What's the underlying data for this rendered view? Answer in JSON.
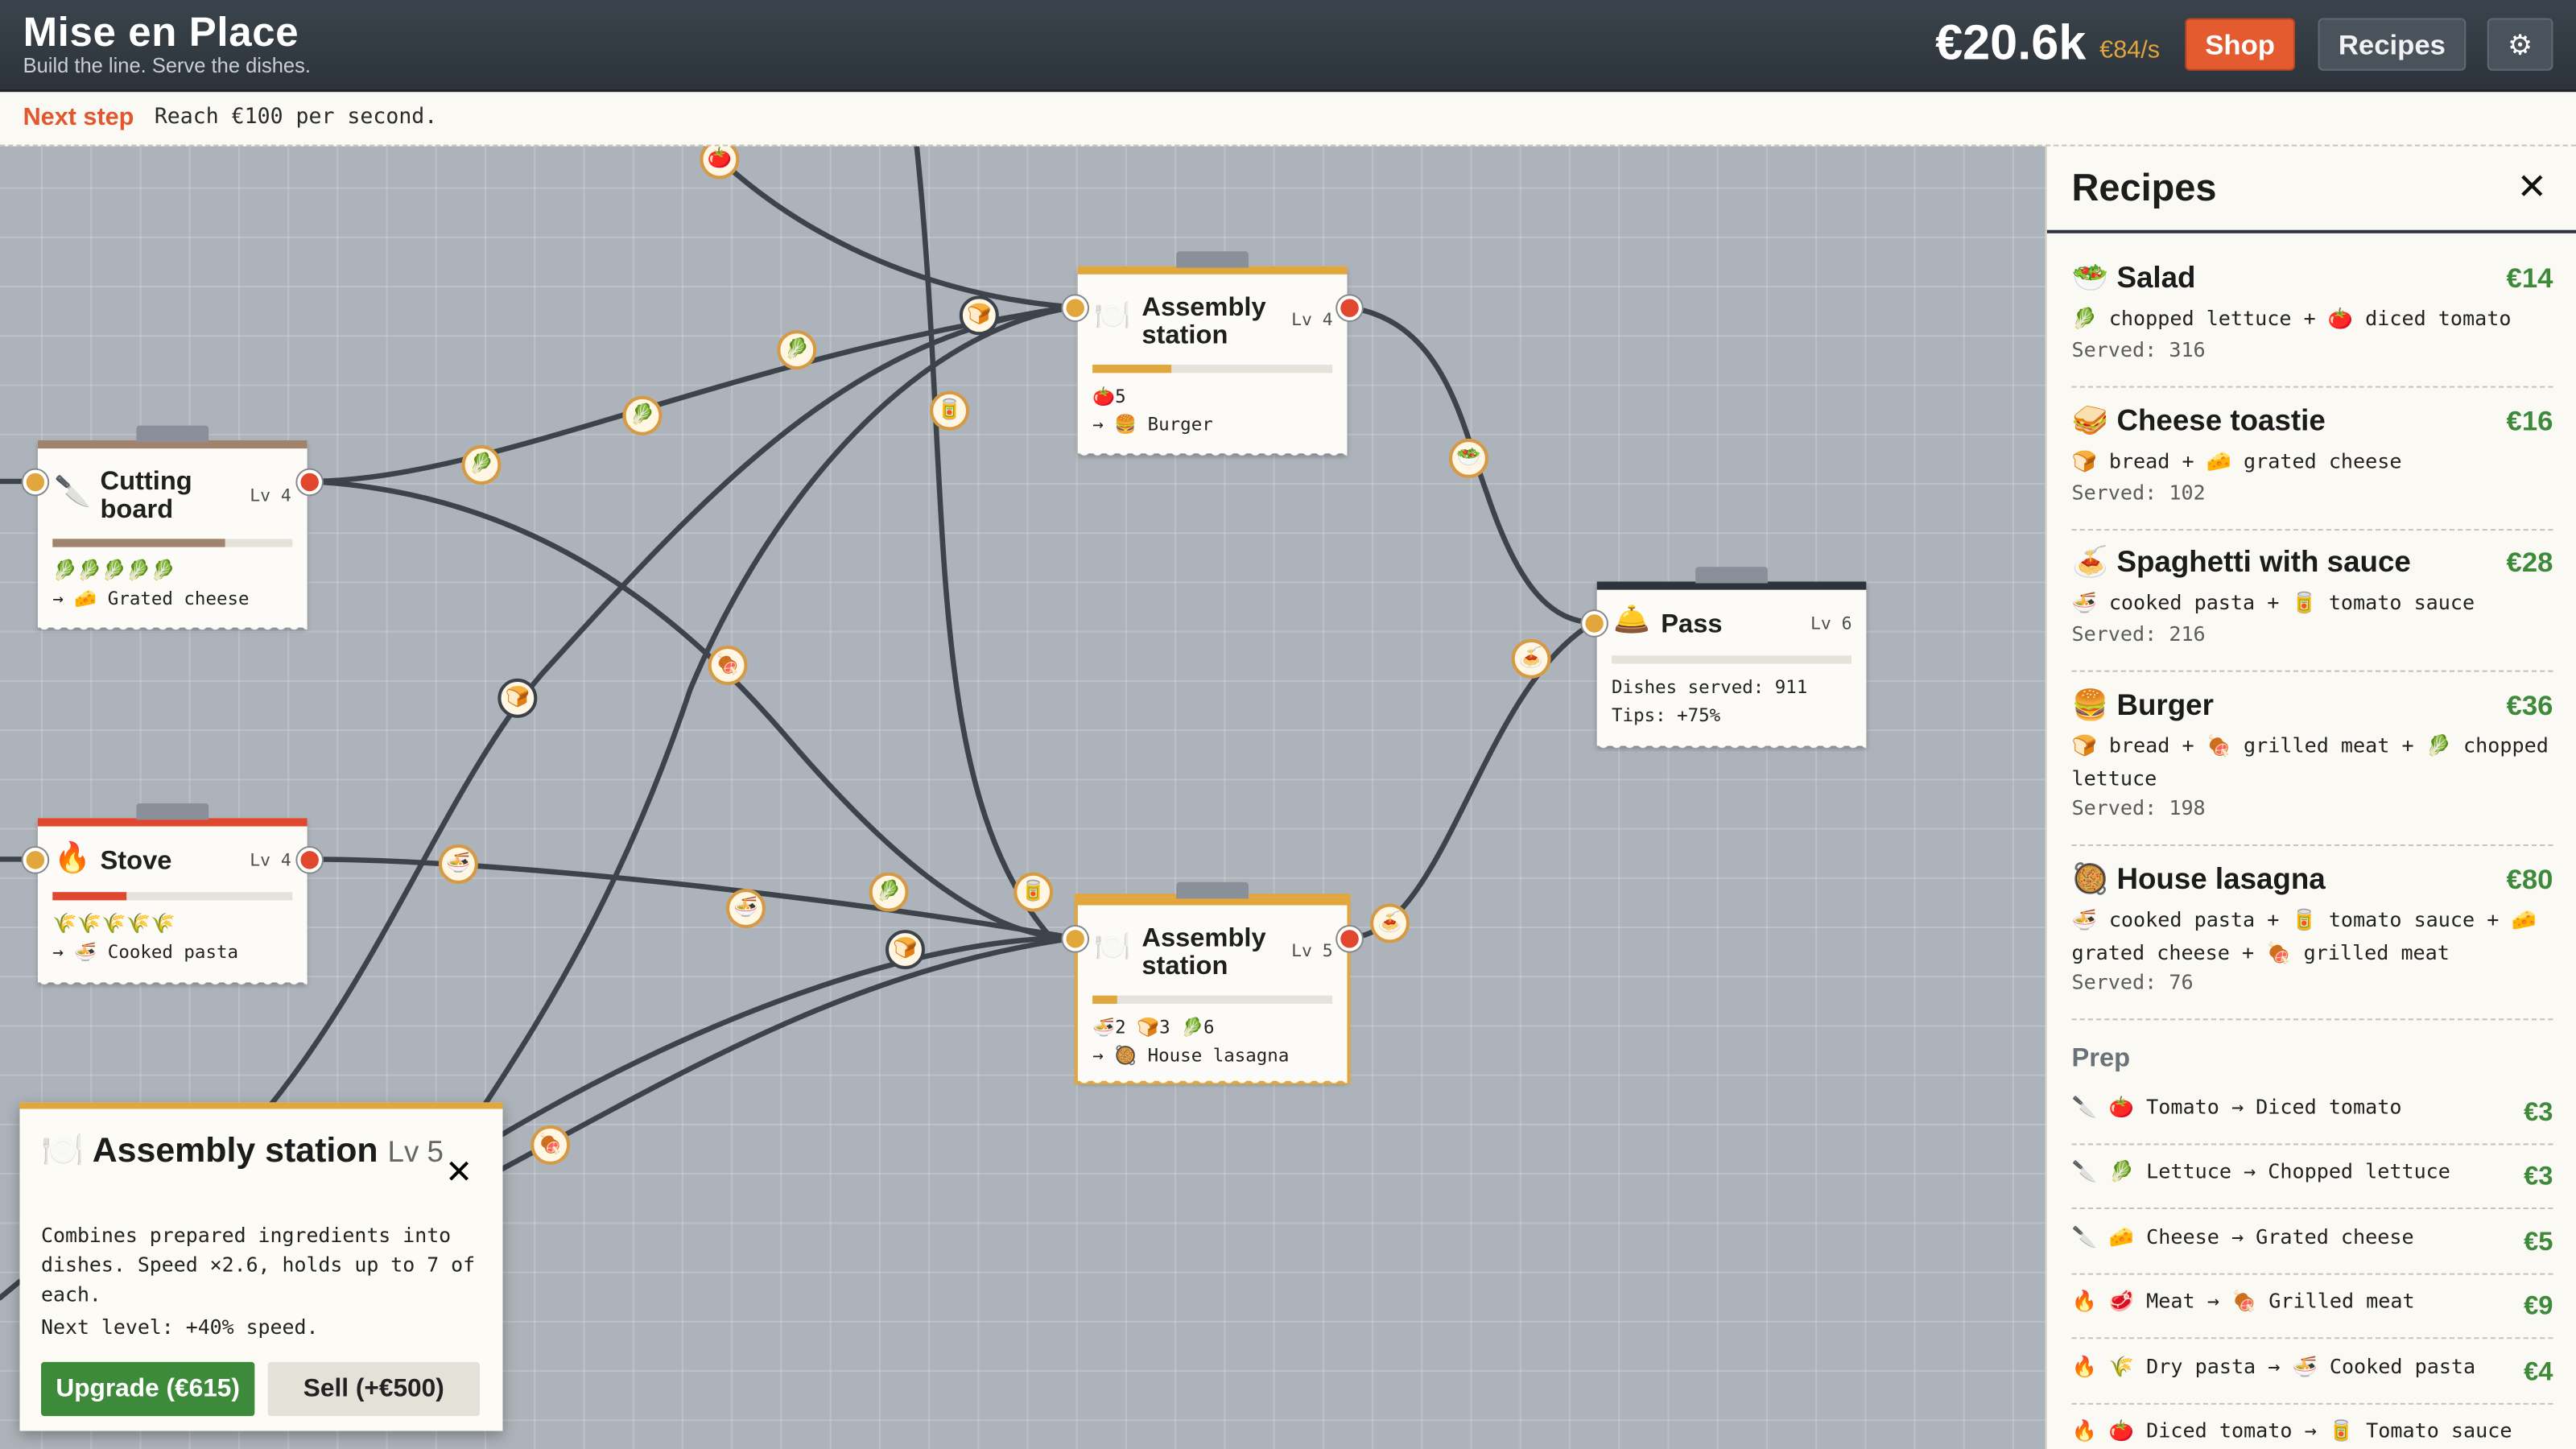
{
  "app": {
    "title": "Mise en Place",
    "subtitle": "Build the line. Serve the dishes."
  },
  "topbar": {
    "money": "€20.6k",
    "rate": "€84/s",
    "shop_label": "Shop",
    "recipes_label": "Recipes",
    "settings_icon": "gear-icon"
  },
  "next_step": {
    "label": "Next step",
    "text": "Reach €100 per second."
  },
  "machines": {
    "cutting_board": {
      "icon": "🔪",
      "name": "Cutting board",
      "level": "Lv 4",
      "inventory": "🥬🥬🥬🥬🥬",
      "output": "→ 🧀 Grated cheese",
      "progress": 0.72,
      "accent": "#a0826d"
    },
    "stove": {
      "icon": "🔥",
      "name": "Stove",
      "level": "Lv 4",
      "inventory": "🌾🌾🌾🌾🌾",
      "output": "→ 🍜 Cooked pasta",
      "progress": 0.31,
      "accent": "#e1462f"
    },
    "assembly_top": {
      "icon": "🍽️",
      "name": "Assembly station",
      "level": "Lv 4",
      "inventory": "🍅5",
      "output": "→ 🍔 Burger",
      "progress": 0.33,
      "accent": "#e2a73c"
    },
    "assembly_bottom": {
      "icon": "🍽️",
      "name": "Assembly station",
      "level": "Lv 5",
      "inventory": "🍜2 🍞3 🥬6",
      "output": "→ 🥘 House lasagna",
      "progress": 0.1,
      "accent": "#e2a73c"
    },
    "pass": {
      "icon": "🛎️",
      "name": "Pass",
      "level": "Lv 6",
      "served": "Dishes served: 911",
      "tips": "Tips: +75%",
      "accent": "#2e343b"
    }
  },
  "tokens": [
    "🍅",
    "🍞",
    "🥬",
    "🥬",
    "🥫",
    "🥬",
    "🍞",
    "🍖",
    "🥗",
    "🍝",
    "🍜",
    "🍜",
    "🥬",
    "🍞",
    "🥫",
    "🍝",
    "🍖"
  ],
  "recipes_panel": {
    "title": "Recipes",
    "close": "✕",
    "recipes": [
      {
        "icon": "🥗",
        "name": "Salad",
        "price": "€14",
        "ingredients": "🥬 chopped lettuce + 🍅 diced tomato",
        "served": "Served: 316"
      },
      {
        "icon": "🥪",
        "name": "Cheese toastie",
        "price": "€16",
        "ingredients": "🍞 bread + 🧀 grated cheese",
        "served": "Served: 102"
      },
      {
        "icon": "🍝",
        "name": "Spaghetti with sauce",
        "price": "€28",
        "ingredients": "🍜 cooked pasta + 🥫 tomato sauce",
        "served": "Served: 216"
      },
      {
        "icon": "🍔",
        "name": "Burger",
        "price": "€36",
        "ingredients": "🍞 bread + 🍖 grilled meat + 🥬 chopped lettuce",
        "served": "Served: 198"
      },
      {
        "icon": "🥘",
        "name": "House lasagna",
        "price": "€80",
        "ingredients": "🍜 cooked pasta + 🥫 tomato sauce + 🧀 grated cheese + 🍖 grilled meat",
        "served": "Served: 76"
      }
    ],
    "prep_title": "Prep",
    "prep": [
      {
        "text": "🔪 🍅 Tomato → Diced tomato",
        "price": "€3"
      },
      {
        "text": "🔪 🥬 Lettuce → Chopped lettuce",
        "price": "€3"
      },
      {
        "text": "🔪 🧀 Cheese → Grated cheese",
        "price": "€5"
      },
      {
        "text": "🔥 🥩 Meat → 🍖 Grilled meat",
        "price": "€9"
      },
      {
        "text": "🔥 🌾 Dry pasta → 🍜 Cooked pasta",
        "price": "€4"
      },
      {
        "text": "🔥 🍅 Diced tomato → 🥫 Tomato sauce",
        "price": ""
      }
    ]
  },
  "popup": {
    "icon": "🍽️",
    "title": "Assembly station",
    "level": "Lv 5",
    "close": "✕",
    "description": "Combines prepared ingredients into dishes. Speed ×2.6, holds up to 7 of each.",
    "next_level": "Next level: +40% speed.",
    "upgrade_label": "Upgrade (€615)",
    "sell_label": "Sell (+€500)"
  }
}
